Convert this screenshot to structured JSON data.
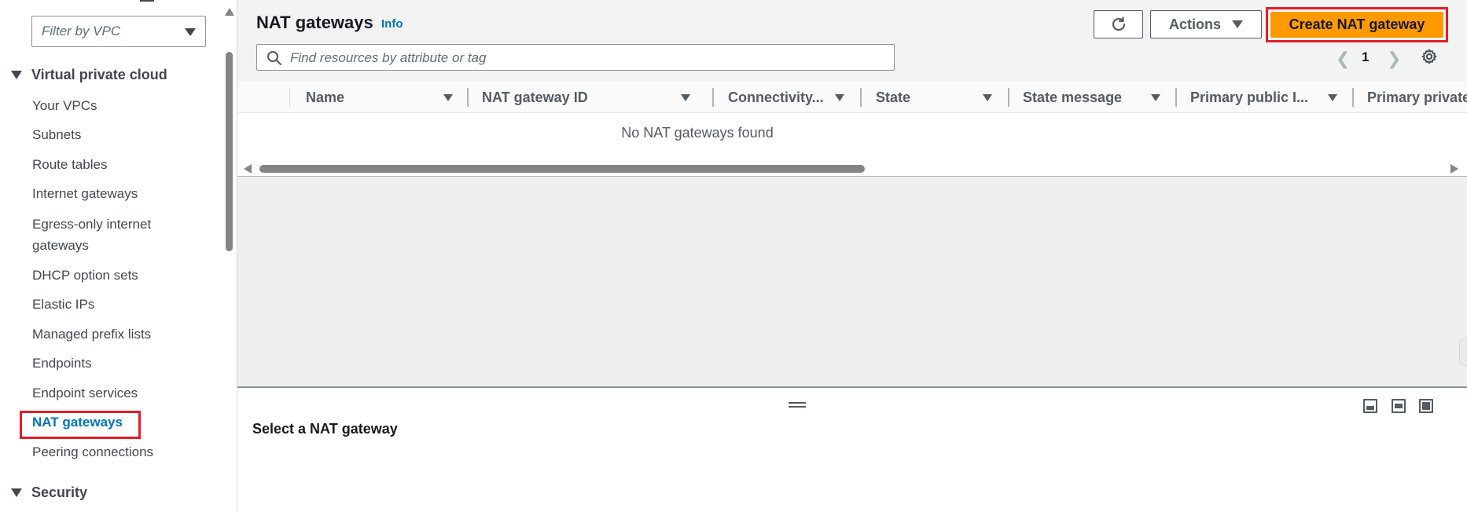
{
  "sidebar": {
    "vpc_filter_placeholder": "Filter by VPC",
    "section_vpc": "Virtual private cloud",
    "items": [
      {
        "label": "Your VPCs"
      },
      {
        "label": "Subnets"
      },
      {
        "label": "Route tables"
      },
      {
        "label": "Internet gateways"
      },
      {
        "label": "Egress-only internet"
      },
      {
        "label": "gateways"
      },
      {
        "label": "DHCP option sets"
      },
      {
        "label": "Elastic IPs"
      },
      {
        "label": "Managed prefix lists"
      },
      {
        "label": "Endpoints"
      },
      {
        "label": "Endpoint services"
      },
      {
        "label": "NAT gateways"
      },
      {
        "label": "Peering connections"
      }
    ],
    "section_security": "Security"
  },
  "header": {
    "title": "NAT gateways",
    "info": "Info",
    "actions_label": "Actions",
    "create_label": "Create NAT gateway"
  },
  "search": {
    "placeholder": "Find resources by attribute or tag"
  },
  "pagination": {
    "current_page": "1"
  },
  "table": {
    "columns": [
      {
        "label": "Name"
      },
      {
        "label": "NAT gateway ID"
      },
      {
        "label": "Connectivity..."
      },
      {
        "label": "State"
      },
      {
        "label": "State message"
      },
      {
        "label": "Primary public I..."
      },
      {
        "label": "Primary private"
      }
    ],
    "empty_message": "No NAT gateways found"
  },
  "details": {
    "title": "Select a NAT gateway"
  },
  "colors": {
    "accent_orange": "#ff9900",
    "link_blue": "#0073bb",
    "highlight_red": "#e01e26"
  }
}
